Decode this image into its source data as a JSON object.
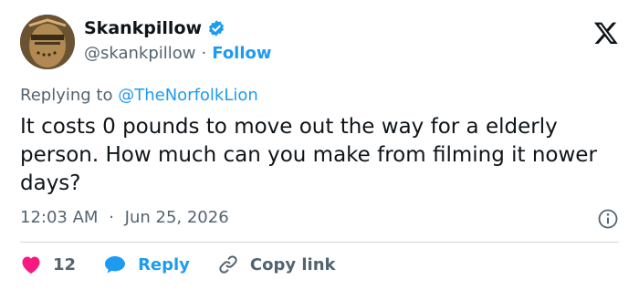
{
  "user": {
    "display_name": "Skankpillow",
    "handle": "@skankpillow",
    "separator": "·",
    "follow_label": "Follow"
  },
  "reply": {
    "prefix": "Replying to",
    "mention": "@TheNorfolkLion"
  },
  "tweet": {
    "text": "It costs 0 pounds to move out the way for a elderly person. How much can you make from filming it nower days?"
  },
  "meta": {
    "time": "12:03 AM",
    "separator": "·",
    "date": "Jun 25, 2026"
  },
  "actions": {
    "like_count": "12",
    "reply_label": "Reply",
    "copy_label": "Copy link"
  },
  "icons": {
    "verified": "verified-badge-icon",
    "x": "x-logo-icon",
    "info": "info-icon",
    "like": "heart-icon",
    "reply": "chat-bubble-icon",
    "copy": "link-icon"
  },
  "colors": {
    "accent": "#1d9bf0",
    "like": "#f91880",
    "text": "#0f1419",
    "muted": "#536471",
    "divider": "#cfd9de"
  }
}
